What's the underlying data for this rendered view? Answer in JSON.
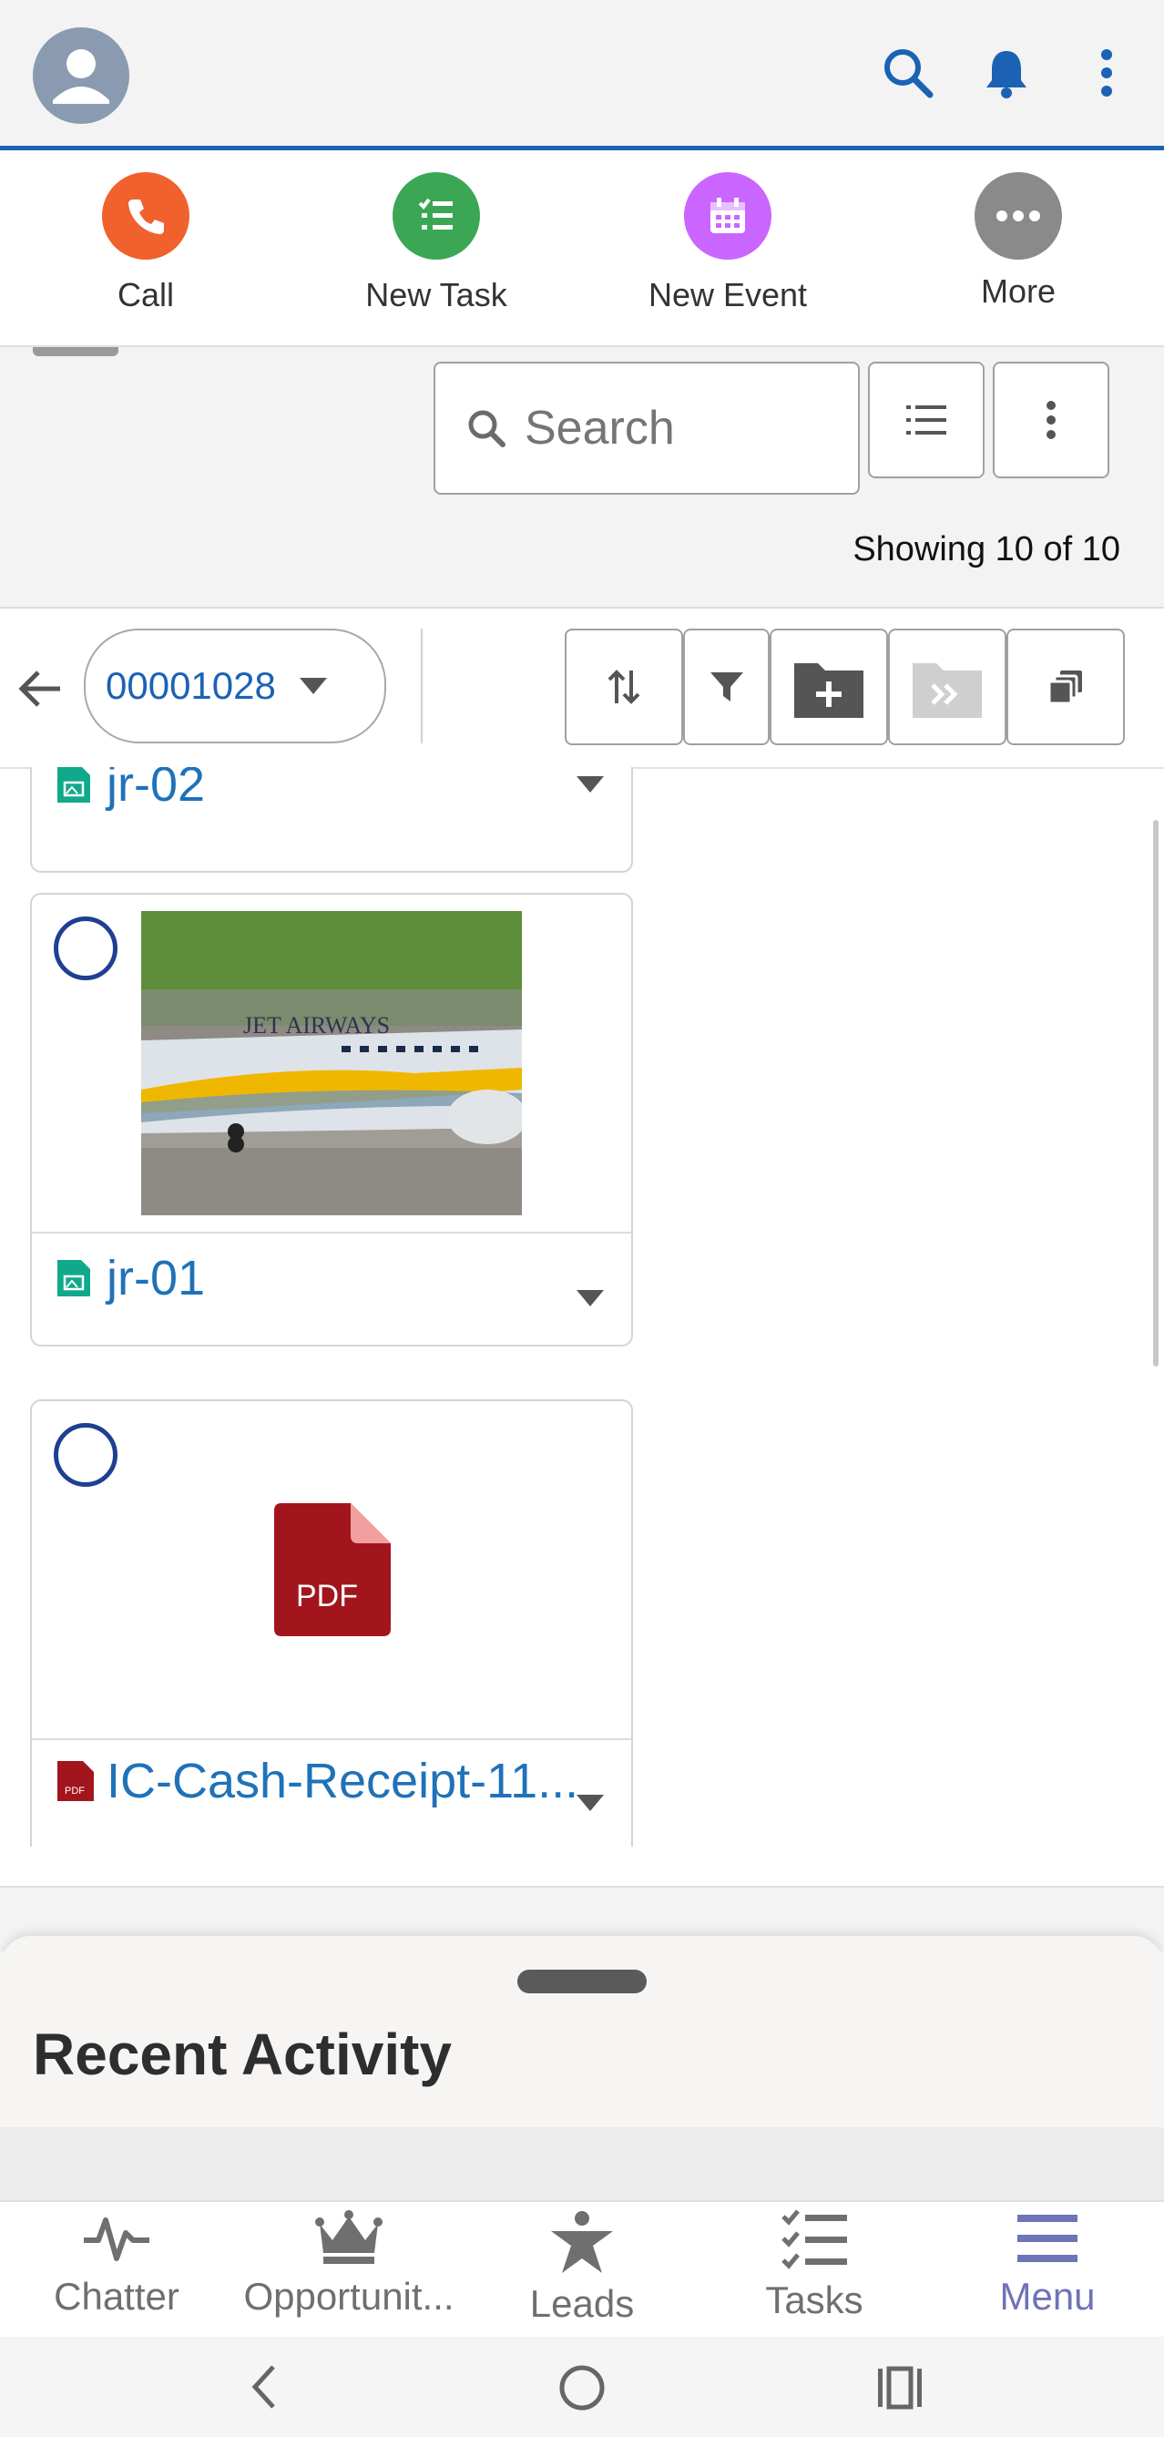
{
  "header": {
    "avatar_icon": "user-avatar-icon",
    "search_icon": "search-icon",
    "bell_icon": "bell-icon",
    "more_icon": "more-vertical-icon",
    "accent": "#1b62b5"
  },
  "quick_actions": [
    {
      "label": "Call",
      "icon": "phone-icon",
      "color": "#f0612e"
    },
    {
      "label": "New Task",
      "icon": "task-list-icon",
      "color": "#3ba755"
    },
    {
      "label": "New Event",
      "icon": "calendar-icon",
      "color": "#cb65ff"
    },
    {
      "label": "More",
      "icon": "ellipsis-icon",
      "color": "#8a8a8a"
    }
  ],
  "search": {
    "placeholder": "Search"
  },
  "list_status": {
    "text": "Showing 10 of 10"
  },
  "folder": {
    "label": "00001028"
  },
  "files": [
    {
      "name": "jr-02",
      "type": "image"
    },
    {
      "name": "jr-01",
      "type": "image",
      "thumb_text": "JET AIRWAYS"
    },
    {
      "name": "IC-Cash-Receipt-11...",
      "type": "pdf",
      "thumb_text": "PDF",
      "icon_text": "PDF"
    }
  ],
  "recent_activity": {
    "title": "Recent Activity"
  },
  "bottom_nav": [
    {
      "label": "Chatter",
      "icon": "activity-pulse-icon"
    },
    {
      "label": "Opportunit...",
      "icon": "crown-icon"
    },
    {
      "label": "Leads",
      "icon": "star-person-icon"
    },
    {
      "label": "Tasks",
      "icon": "checklist-icon"
    },
    {
      "label": "Menu",
      "icon": "hamburger-menu-icon",
      "active": true
    }
  ]
}
